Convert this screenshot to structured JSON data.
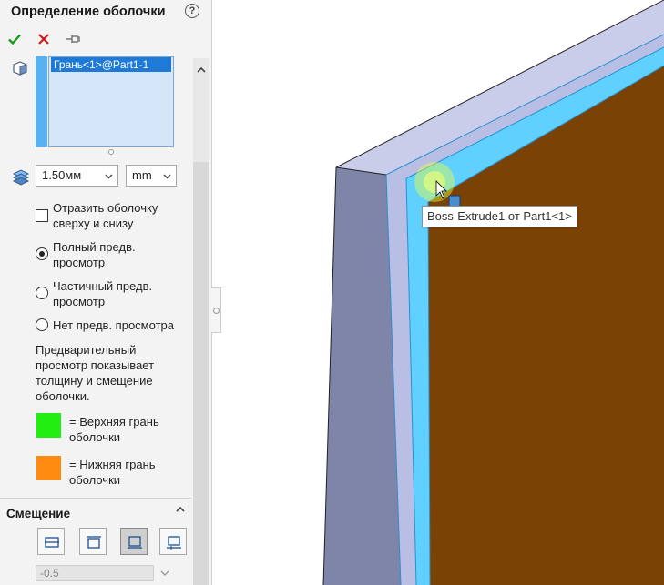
{
  "panel": {
    "title": "Определение оболочки",
    "help_glyph": "?",
    "actions": {
      "ok_icon": "check-icon",
      "cancel_icon": "close-icon",
      "pin_icon": "pushpin-icon"
    },
    "selection": {
      "items": [
        "Грань<1>@Part1-1"
      ]
    },
    "thickness": {
      "value": "1.50мм",
      "unit": "mm"
    },
    "options": {
      "flip_checkbox": {
        "label_line1": "Отразить оболочку",
        "label_line2": "сверху и снизу",
        "checked": false
      },
      "preview_full": {
        "label_line1": "Полный предв.",
        "label_line2": "просмотр",
        "selected": true
      },
      "preview_partial": {
        "label_line1": "Частичный предв.",
        "label_line2": "просмотр",
        "selected": false
      },
      "preview_none": {
        "label": "Нет предв. просмотра",
        "selected": false
      }
    },
    "info_text": [
      "Предварительный",
      "просмотр показывает",
      "толщину и смещение",
      "оболочки."
    ],
    "legend": {
      "top": {
        "line1": "= Верхняя грань",
        "line2": "оболочки",
        "color": "#22ee11"
      },
      "bottom": {
        "line1": "= Нижняя грань",
        "line2": "оболочки",
        "color": "#ff8a10"
      }
    },
    "offset_section": {
      "title": "Смещение",
      "value": "-0.5",
      "buttons": [
        "offset-middle-icon",
        "offset-top-icon",
        "offset-bottom-icon",
        "offset-custom-icon"
      ],
      "selected_index": 2
    }
  },
  "viewport": {
    "tooltip": "Boss-Extrude1 от Part1<1>",
    "colors": {
      "top_face": "#c9cdea",
      "side_face": "#7f85a8",
      "inner_frame": "#5fd0ff",
      "bottom_face": "#7a4204"
    }
  }
}
